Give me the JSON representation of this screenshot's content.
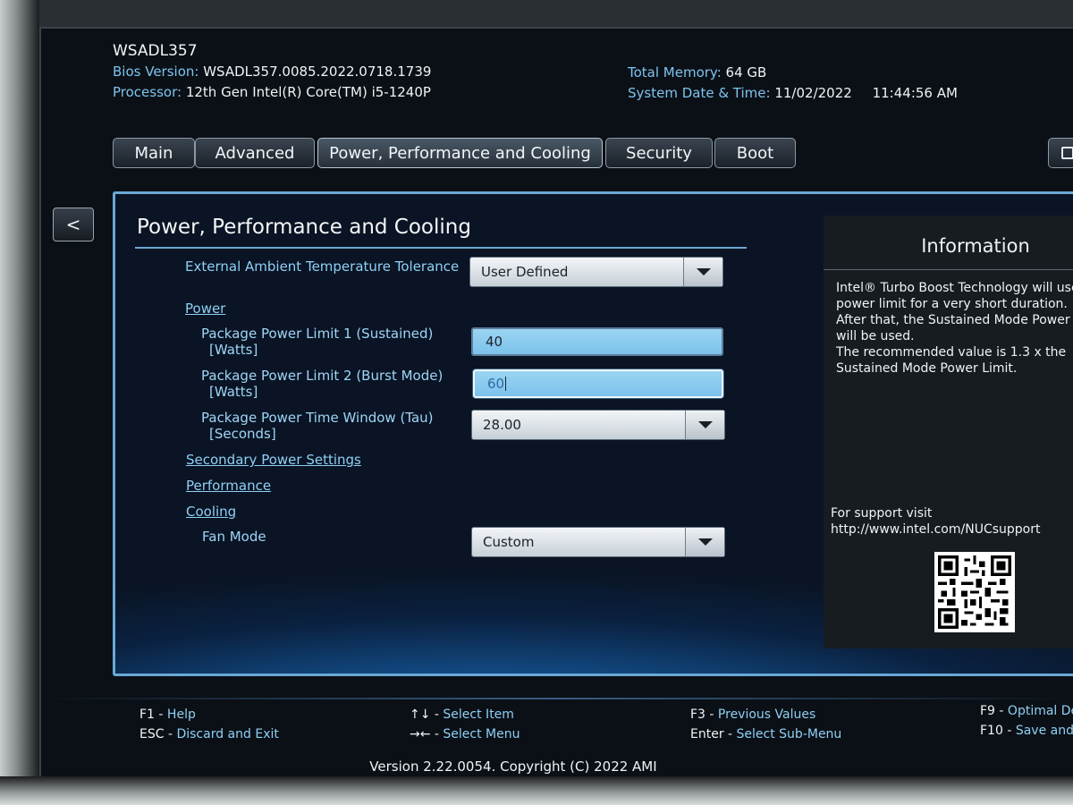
{
  "header": {
    "hostname": "WSADL357",
    "bios_label": "Bios Version:",
    "bios_value": "WSADL357.0085.2022.0718.1739",
    "processor_label": "Processor:",
    "processor_value": "12th Gen Intel(R) Core(TM) i5-1240P",
    "memory_label": "Total Memory:",
    "memory_value": "64 GB",
    "datetime_label": "System Date & Time:",
    "date_value": "11/02/2022",
    "time_value": "11:44:56 AM"
  },
  "tabs": [
    {
      "label": "Main"
    },
    {
      "label": "Advanced"
    },
    {
      "label": "Power, Performance and Cooling"
    },
    {
      "label": "Security"
    },
    {
      "label": "Boot"
    }
  ],
  "back_label": "<",
  "panel": {
    "title": "Power, Performance and Cooling",
    "ambient_label": "External Ambient Temperature Tolerance",
    "ambient_value": "User Defined",
    "power_link": "Power",
    "ppl1_label": "Package Power Limit 1 (Sustained)",
    "ppl1_unit": "[Watts]",
    "ppl1_value": "40",
    "ppl2_label": "Package Power Limit 2 (Burst Mode)",
    "ppl2_unit": "[Watts]",
    "ppl2_value": "60",
    "tau_label": "Package Power Time Window (Tau)",
    "tau_unit": "[Seconds]",
    "tau_value": "28.00",
    "secondary_link": "Secondary Power Settings",
    "performance_link": "Performance",
    "cooling_link": "Cooling",
    "fan_label": "Fan Mode",
    "fan_value": "Custom"
  },
  "info": {
    "title": "Information",
    "text": "Intel® Turbo Boost Technology will use\npower limit for a very short duration.\nAfter that, the Sustained Mode Power L\nwill be used.\nThe recommended value is 1.3 x the\nSustained Mode Power Limit.",
    "support_line1": "For support visit",
    "support_line2": "http://www.intel.com/NUCsupport"
  },
  "footer": {
    "f1_key": "F1",
    "f1_label": "Help",
    "esc_key": "ESC",
    "esc_label": "Discard and Exit",
    "updown_key": "↑↓",
    "updown_label": "Select Item",
    "leftright_key": "→←",
    "leftright_label": "Select Menu",
    "f3_key": "F3",
    "f3_label": "Previous Values",
    "enter_key": "Enter",
    "enter_label": "Select Sub-Menu",
    "f9_key": "F9",
    "f9_label": "Optimal Def",
    "f10_key": "F10",
    "f10_label": "Save and E",
    "version": "Version 2.22.0054. Copyright (C) 2022 AMI"
  }
}
